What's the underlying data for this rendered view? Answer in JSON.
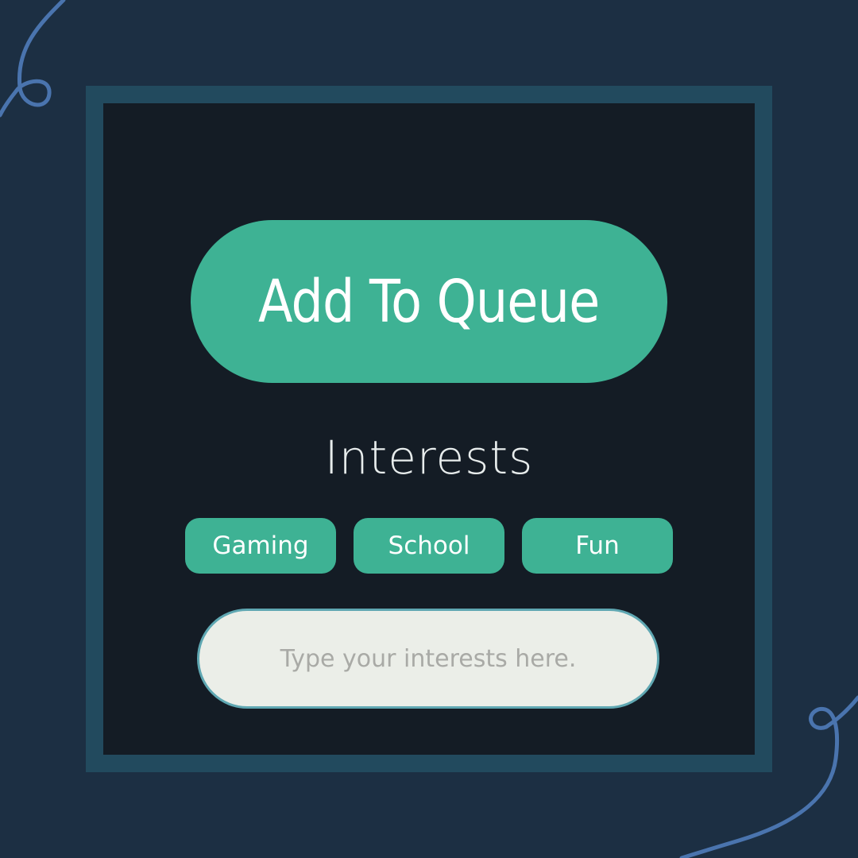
{
  "colors": {
    "background": "#1c2f43",
    "frame": "#224a5e",
    "panel": "#141c25",
    "accent": "#3eb294",
    "input_background": "#ebeee8",
    "input_border": "#5fa7b2",
    "squiggle": "#4a74ae"
  },
  "queue_button": {
    "label": "Add To Queue"
  },
  "interests": {
    "heading": "Interests",
    "tags": [
      {
        "label": "Gaming"
      },
      {
        "label": "School"
      },
      {
        "label": "Fun"
      }
    ],
    "input": {
      "value": "",
      "placeholder": "Type your interests here."
    }
  },
  "decorations": {
    "top_left": "squiggle-loop",
    "bottom_right": "squiggle-loop"
  }
}
